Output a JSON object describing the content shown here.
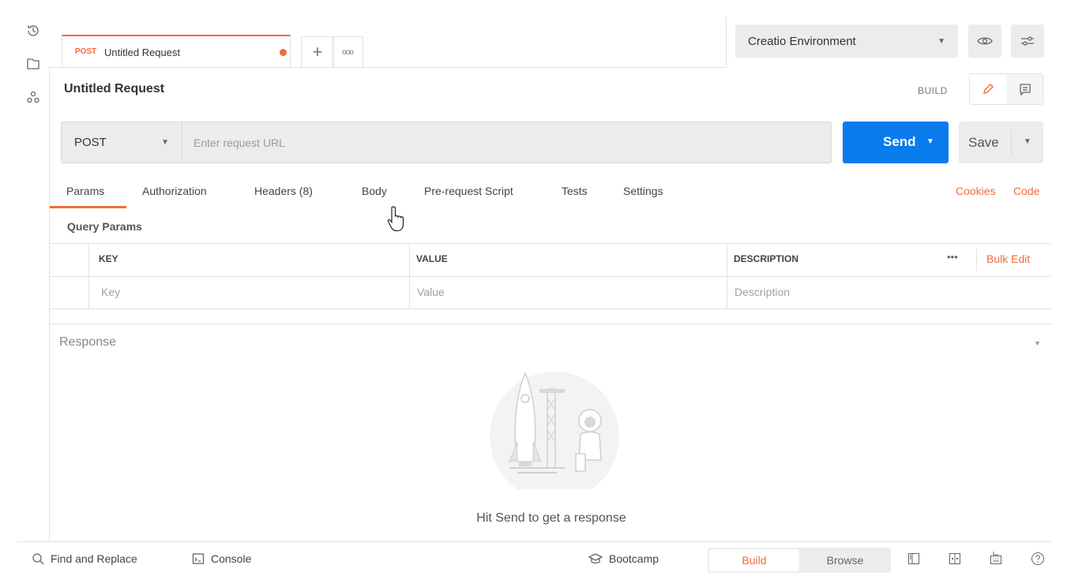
{
  "tabs": {
    "active": {
      "method": "POST",
      "title": "Untitled Request"
    },
    "add_label": "+",
    "more_label": "ooo"
  },
  "environment": {
    "selected": "Creatio Environment"
  },
  "request": {
    "name": "Untitled Request",
    "mode_label": "BUILD",
    "method": "POST",
    "url_placeholder": "Enter request URL",
    "send_label": "Send",
    "save_label": "Save"
  },
  "request_tabs": [
    "Params",
    "Authorization",
    "Headers (8)",
    "Body",
    "Pre-request Script",
    "Tests",
    "Settings"
  ],
  "links": {
    "cookies": "Cookies",
    "code": "Code"
  },
  "params": {
    "section_title": "Query Params",
    "columns": {
      "key": "KEY",
      "value": "VALUE",
      "description": "DESCRIPTION"
    },
    "more": "•••",
    "bulk_edit": "Bulk Edit",
    "placeholders": {
      "key": "Key",
      "value": "Value",
      "description": "Description"
    }
  },
  "response": {
    "title": "Response",
    "empty_message": "Hit Send to get a response"
  },
  "footer": {
    "find_replace": "Find and Replace",
    "console": "Console",
    "bootcamp": "Bootcamp",
    "build": "Build",
    "browse": "Browse"
  },
  "colors": {
    "accent": "#f26b3a",
    "send_blue": "#097bed",
    "panel_gray": "#ececec"
  }
}
